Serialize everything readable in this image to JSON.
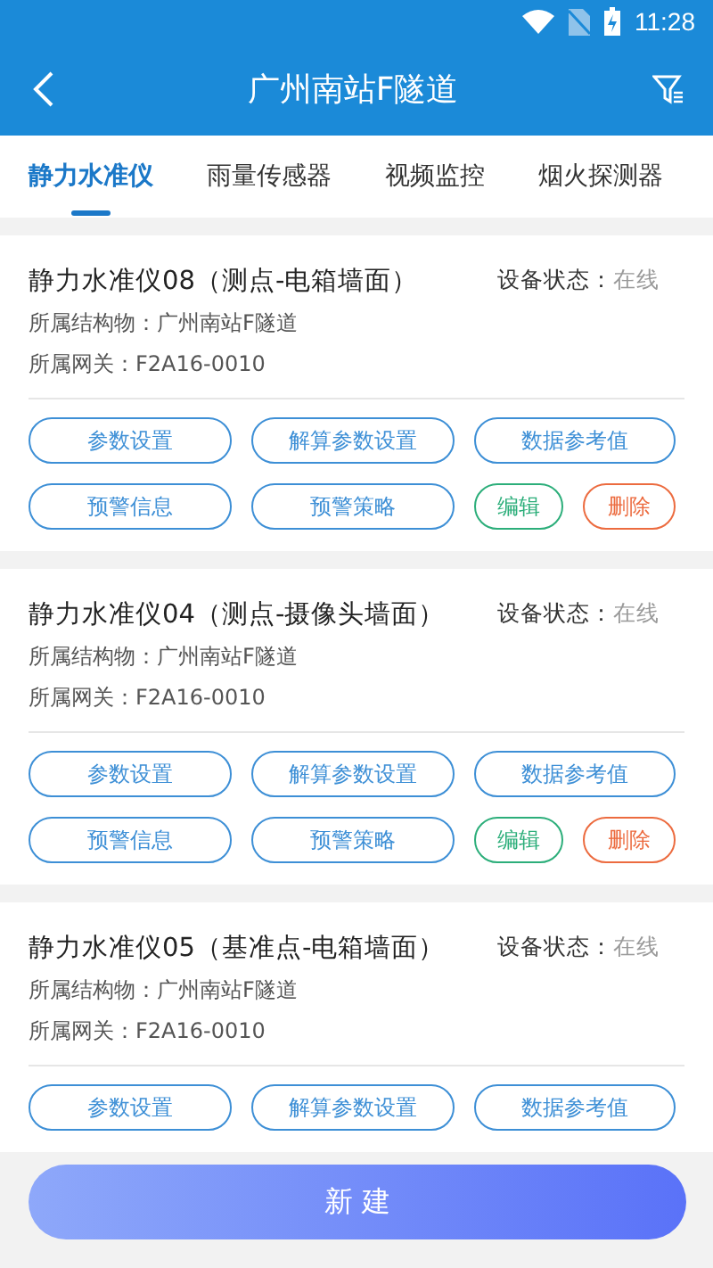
{
  "status_bar": {
    "time": "11:28"
  },
  "header": {
    "title": "广州南站F隧道"
  },
  "tabs": [
    {
      "label": "静力水准仪",
      "selected": true
    },
    {
      "label": "雨量传感器",
      "selected": false
    },
    {
      "label": "视频监控",
      "selected": false
    },
    {
      "label": "烟火探测器",
      "selected": false
    }
  ],
  "devices": [
    {
      "name": "静力水准仪08（测点-电箱墙面）",
      "status_label": "设备状态：",
      "status": "在线",
      "structure": "所属结构物：广州南站F隧道",
      "gateway": "所属网关：F2A16-0010",
      "buttons": [
        {
          "label": "参数设置",
          "kind": "action"
        },
        {
          "label": "解算参数设置",
          "kind": "action"
        },
        {
          "label": "数据参考值",
          "kind": "action"
        },
        {
          "label": "预警信息",
          "kind": "action"
        },
        {
          "label": "预警策略",
          "kind": "action"
        },
        {
          "label": "编辑",
          "kind": "edit"
        },
        {
          "label": "删除",
          "kind": "delete"
        }
      ]
    },
    {
      "name": "静力水准仪04（测点-摄像头墙面）",
      "status_label": "设备状态：",
      "status": "在线",
      "structure": "所属结构物：广州南站F隧道",
      "gateway": "所属网关：F2A16-0010",
      "buttons": [
        {
          "label": "参数设置",
          "kind": "action"
        },
        {
          "label": "解算参数设置",
          "kind": "action"
        },
        {
          "label": "数据参考值",
          "kind": "action"
        },
        {
          "label": "预警信息",
          "kind": "action"
        },
        {
          "label": "预警策略",
          "kind": "action"
        },
        {
          "label": "编辑",
          "kind": "edit"
        },
        {
          "label": "删除",
          "kind": "delete"
        }
      ]
    },
    {
      "name": "静力水准仪05（基准点-电箱墙面）",
      "status_label": "设备状态：",
      "status": "在线",
      "structure": "所属结构物：广州南站F隧道",
      "gateway": "所属网关：F2A16-0010",
      "buttons": [
        {
          "label": "参数设置",
          "kind": "action"
        },
        {
          "label": "解算参数设置",
          "kind": "action"
        },
        {
          "label": "数据参考值",
          "kind": "action"
        }
      ]
    }
  ],
  "create_button": {
    "label": "新 建"
  }
}
